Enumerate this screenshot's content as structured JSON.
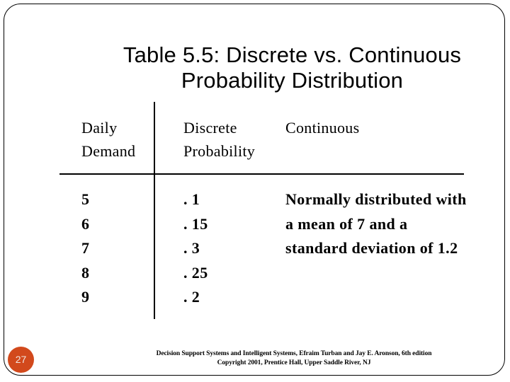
{
  "slide": {
    "title_lines": [
      "Table 5.5: Discrete vs. Continuous",
      "Probability Distribution"
    ],
    "page_number": "27",
    "badge_color": "#D2491C"
  },
  "table": {
    "columns": [
      {
        "header_lines": [
          "Daily",
          "Demand"
        ]
      },
      {
        "header_lines": [
          "Discrete",
          "Probability"
        ]
      },
      {
        "header_lines": [
          "Continuous"
        ]
      }
    ],
    "rows": [
      {
        "daily_demand": "5",
        "discrete_probability": ". 1"
      },
      {
        "daily_demand": "6",
        "discrete_probability": ". 15"
      },
      {
        "daily_demand": "7",
        "discrete_probability": ". 3"
      },
      {
        "daily_demand": "8",
        "discrete_probability": ". 25"
      },
      {
        "daily_demand": "9",
        "discrete_probability": ". 2"
      }
    ],
    "continuous_text_lines": [
      "Normally distributed with",
      "a mean of 7 and a",
      "standard deviation of 1.2"
    ]
  },
  "footer": {
    "lines": [
      "Decision Support Systems and Intelligent Systems, Efraim Turban and Jay E. Aronson, 6th edition",
      "Copyright 2001, Prentice Hall, Upper Saddle River, NJ"
    ]
  }
}
